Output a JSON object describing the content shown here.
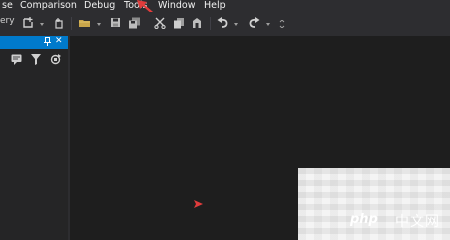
{
  "menubar": {
    "items": [
      {
        "label": "se"
      },
      {
        "label": "Comparison"
      },
      {
        "label": "Debug"
      },
      {
        "label": "Tools"
      },
      {
        "label": "Window"
      },
      {
        "label": "Help"
      }
    ]
  },
  "toolbar": {
    "query_label": "ery",
    "icons": [
      "new-query-icon",
      "new-project-icon",
      "open-folder-icon",
      "save-icon",
      "save-all-icon",
      "cut-icon",
      "copy-icon",
      "paste-icon",
      "undo-icon",
      "redo-icon"
    ]
  },
  "left_panel": {
    "pin_glyph": "\u0002",
    "close_glyph": "✕",
    "title_color": "#007acc"
  },
  "watermark": {
    "brand": "php",
    "site": "中文网"
  },
  "colors": {
    "accent": "#007acc",
    "annotation": "#e03c3c",
    "background": "#1e1e1e",
    "chrome": "#2d2d30"
  }
}
